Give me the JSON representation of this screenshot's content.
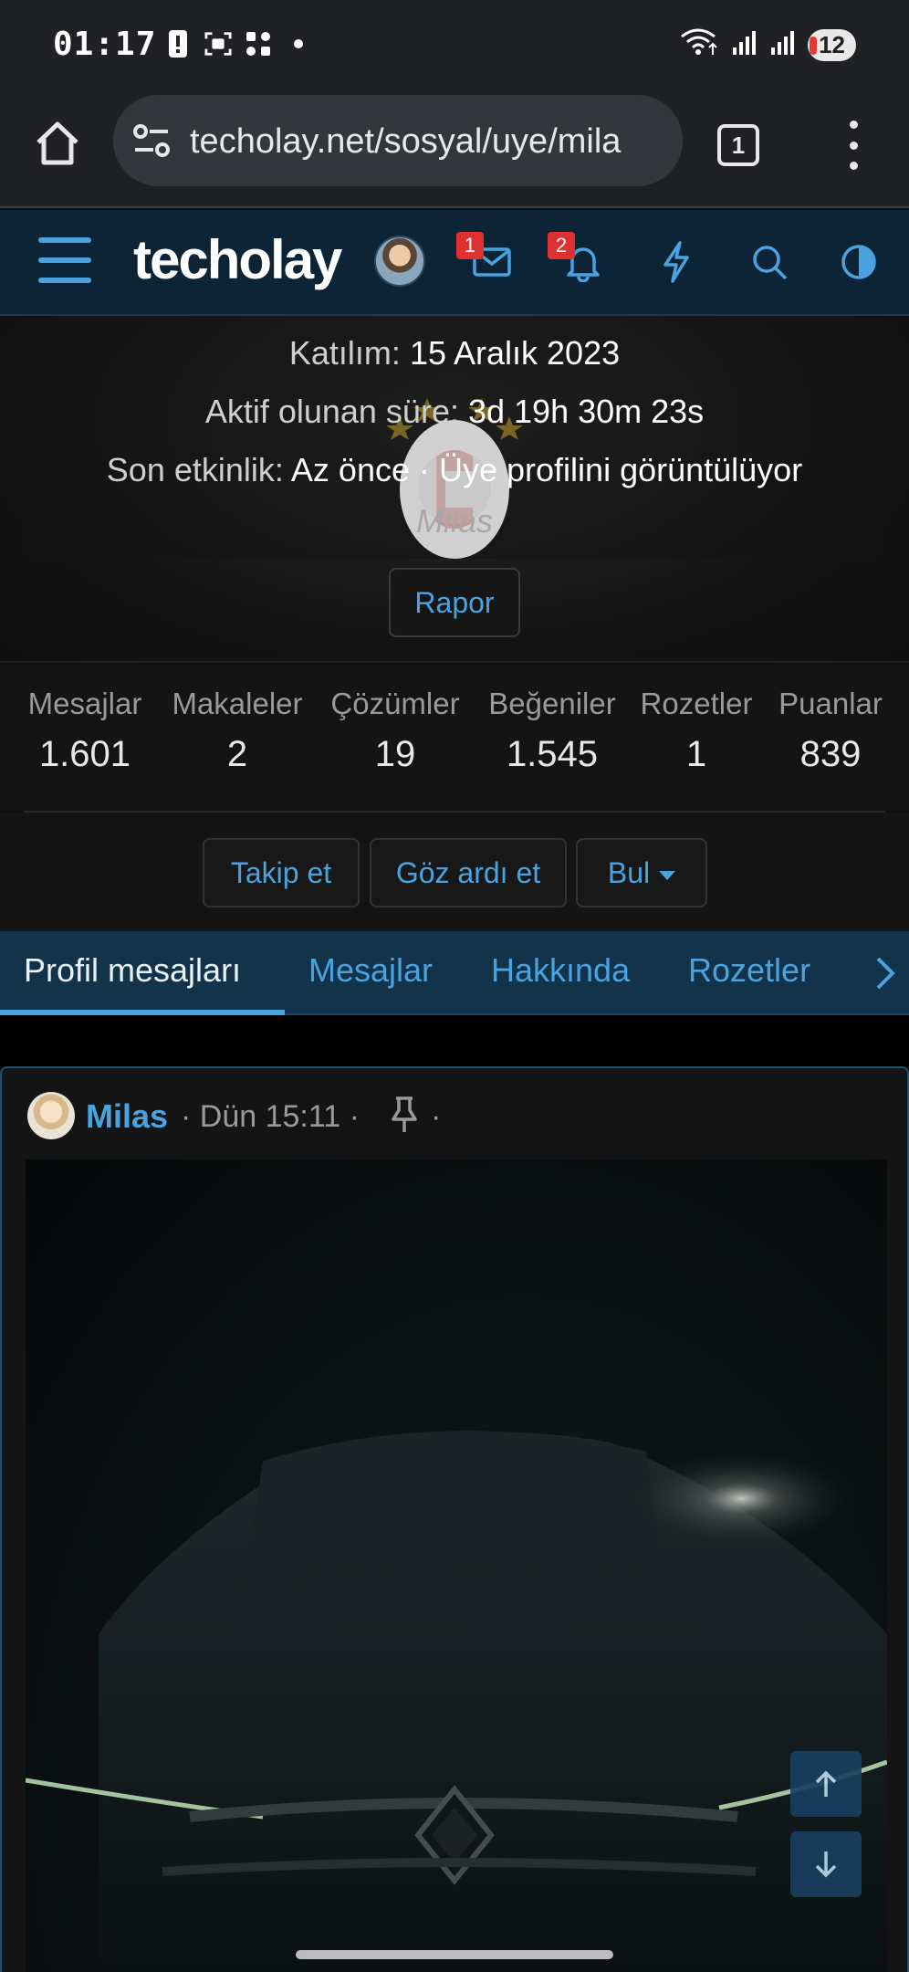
{
  "status_bar": {
    "time": "01:17",
    "battery": "12",
    "icons": [
      "alert-icon",
      "screenshot-icon",
      "grid-icon",
      "dot-icon",
      "wifi-icon",
      "signal-icon",
      "signal-icon",
      "battery-icon"
    ]
  },
  "browser": {
    "url": "techolay.net/sosyal/uye/mila",
    "tab_count": "1"
  },
  "site_header": {
    "logo": "techolay",
    "messages_badge": "1",
    "alerts_badge": "2",
    "accent": "#4aa3df"
  },
  "profile": {
    "joined_label": "Katılım:",
    "joined_value": "15 Aralık 2023",
    "active_label": "Aktif olunan süre:",
    "active_value": "3d 19h 30m 23s",
    "last_activity_label": "Son etkinlik:",
    "last_activity_value": "Az önce · Üye profilini görüntülüyor",
    "username_italic": "Milas",
    "report_button": "Rapor"
  },
  "stats": [
    {
      "label": "Mesajlar",
      "value": "1.601"
    },
    {
      "label": "Makaleler",
      "value": "2"
    },
    {
      "label": "Çözümler",
      "value": "19"
    },
    {
      "label": "Beğeniler",
      "value": "1.545"
    },
    {
      "label": "Rozetler",
      "value": "1"
    },
    {
      "label": "Puanlar",
      "value": "839"
    }
  ],
  "actions": {
    "follow": "Takip et",
    "ignore": "Göz ardı et",
    "find": "Bul"
  },
  "tabs": [
    {
      "label": "Profil mesajları",
      "active": true
    },
    {
      "label": "Mesajlar"
    },
    {
      "label": "Hakkında"
    },
    {
      "label": "Rozetler"
    }
  ],
  "post": {
    "author": "Milas",
    "meta": "· Dün 15:11 ·",
    "trailing_dot": "·"
  }
}
